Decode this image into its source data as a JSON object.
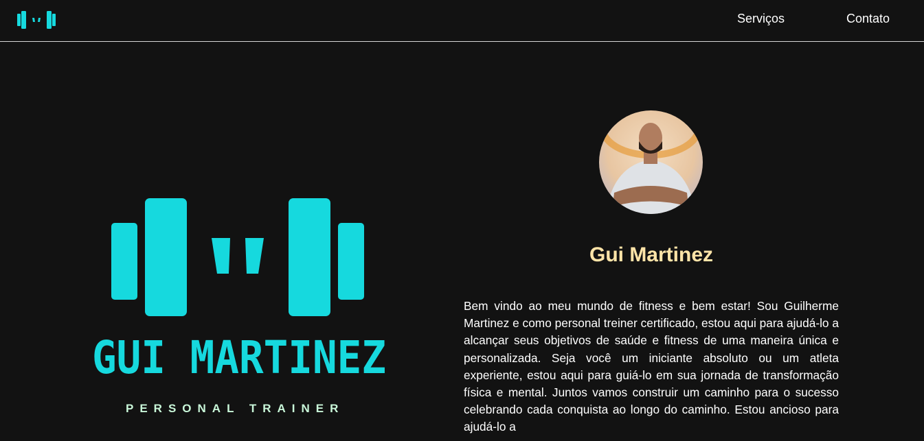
{
  "nav": {
    "logo_icon": "dumbbell-m-logo-icon",
    "links": [
      "Serviços",
      "Contato"
    ]
  },
  "hero": {
    "logo_name": "GUI MARTINEZ",
    "logo_tagline": "PERSONAL TRAINER",
    "colors": {
      "brand": "#16d9de",
      "tagline": "#c9f7d9"
    }
  },
  "profile": {
    "avatar_icon": "profile-photo",
    "name": "Gui Martinez",
    "name_color": "#ffe4a8",
    "bio": "Bem vindo ao meu mundo de fitness e bem estar! Sou Guilherme Martinez e como personal treiner certificado, estou aqui para ajudá-lo a alcançar seus objetivos de saúde e fitness de uma maneira única e personalizada. Seja você um iniciante absoluto ou um atleta experiente, estou aqui para guiá-lo em sua jornada de transformação física e mental. Juntos vamos construir um caminho para o sucesso celebrando cada conquista ao longo do caminho. Estou ancioso para ajudá-lo a"
  }
}
